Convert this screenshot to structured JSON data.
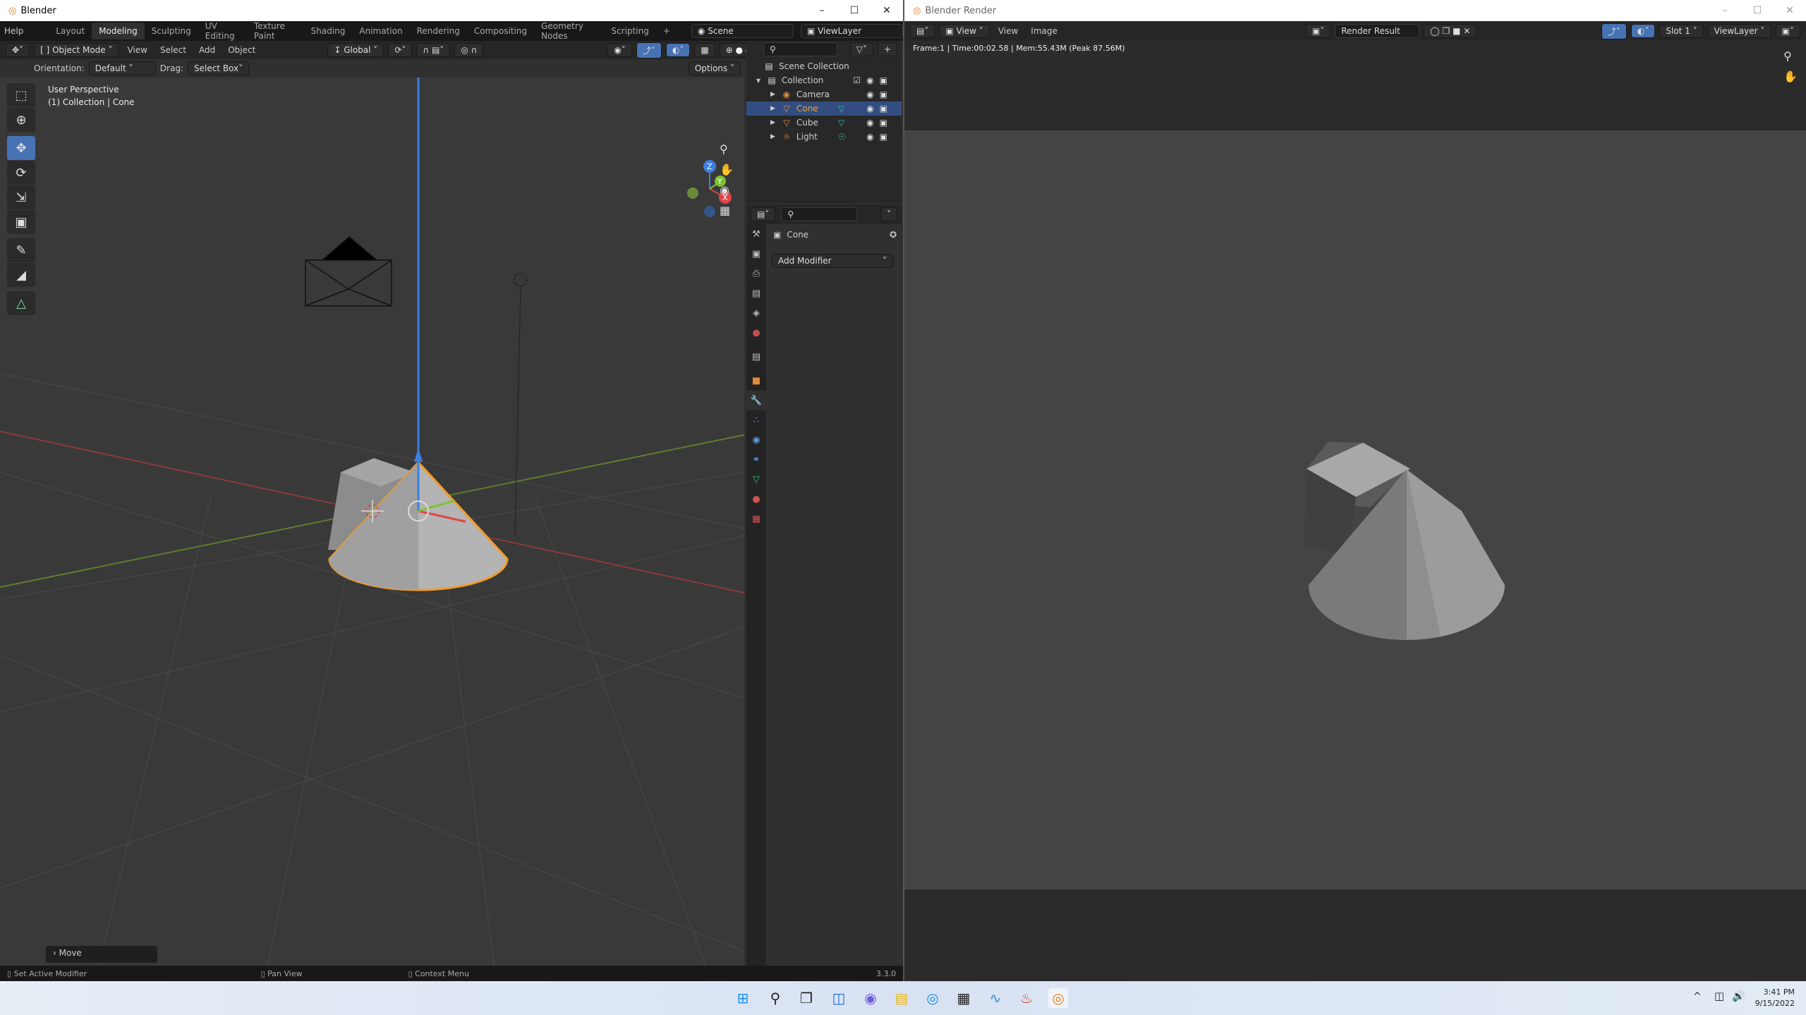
{
  "left_window": {
    "title": "Blender",
    "menu_help": "Help",
    "workspaces": [
      "Layout",
      "Modeling",
      "Sculpting",
      "UV Editing",
      "Texture Paint",
      "Shading",
      "Animation",
      "Rendering",
      "Compositing",
      "Geometry Nodes",
      "Scripting"
    ],
    "active_workspace": "Modeling",
    "add_workspace": "+",
    "scene": "Scene",
    "view_layer": "ViewLayer",
    "header": {
      "mode": "Object Mode",
      "menus": [
        "View",
        "Select",
        "Add",
        "Object"
      ],
      "transform_orientation": "Global"
    },
    "tool_settings": {
      "orientation_label": "Orientation:",
      "orientation": "Default",
      "drag_label": "Drag:",
      "drag": "Select Box",
      "options": "Options"
    },
    "viewport": {
      "overlay_line1": "User Perspective",
      "overlay_line2": "(1) Collection | Cone",
      "last_operator": "Move",
      "gizmo_axes": [
        "X",
        "Y",
        "Z"
      ]
    },
    "outliner": {
      "root": "Scene Collection",
      "collection": "Collection",
      "items": [
        {
          "name": "Camera",
          "icon": "camera-icon",
          "selected": false
        },
        {
          "name": "Cone",
          "icon": "mesh-icon",
          "selected": true
        },
        {
          "name": "Cube",
          "icon": "mesh-icon",
          "selected": false
        },
        {
          "name": "Light",
          "icon": "light-icon",
          "selected": false
        }
      ]
    },
    "properties": {
      "object_name": "Cone",
      "add_modifier": "Add Modifier",
      "tabs": [
        "tool",
        "render",
        "output",
        "view-layer",
        "scene",
        "world",
        "collection",
        "object",
        "modifiers",
        "particles",
        "physics",
        "constraints",
        "data",
        "material",
        "texture"
      ],
      "active_tab": "modifiers"
    },
    "status_bar": {
      "left": "Set Active Modifier",
      "middle": "Pan View",
      "right": "Context Menu",
      "version": "3.3.0"
    }
  },
  "right_window": {
    "title": "Blender Render",
    "menus": [
      "View",
      "View",
      "Image"
    ],
    "image_name": "Render Result",
    "slot": "Slot 1",
    "view_layer": "ViewLayer",
    "info": "Frame:1 | Time:00:02.58 | Mem:55.43M (Peak 87.56M)"
  },
  "taskbar": {
    "time": "3:41 PM",
    "date": "9/15/2022",
    "chevron": "^"
  },
  "colors": {
    "accent": "#4772b3",
    "selection_outline": "#f39c28",
    "viewport_bg": "#393939",
    "title_bg": "#ffffff"
  }
}
